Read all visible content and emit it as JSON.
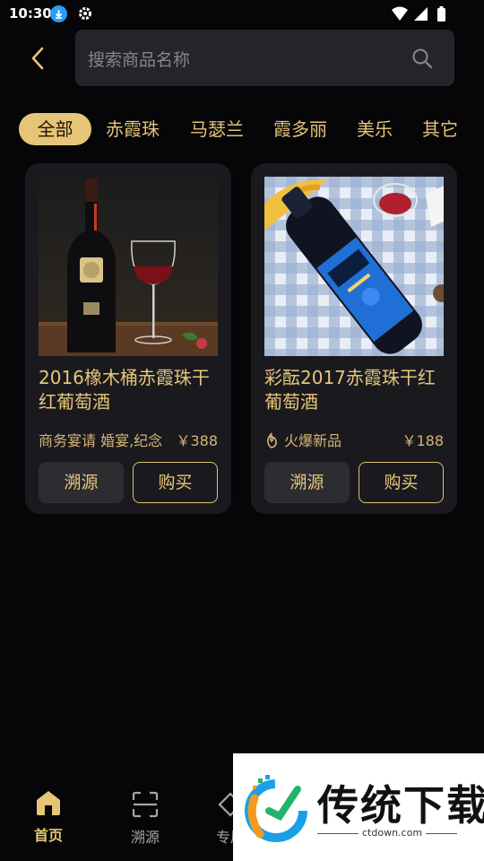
{
  "status": {
    "time": "10:30"
  },
  "search": {
    "placeholder": "搜索商品名称"
  },
  "tabs": [
    "全部",
    "赤霞珠",
    "马瑟兰",
    "霞多丽",
    "美乐",
    "其它"
  ],
  "products": [
    {
      "name": "2016橡木桶赤霞珠干红葡萄酒",
      "tag": "商务宴请 婚宴,纪念",
      "price": "￥388",
      "trace_label": "溯源",
      "buy_label": "购买"
    },
    {
      "name": "彩酝2017赤霞珠干红葡萄酒",
      "tag": "火爆新品",
      "price": "￥188",
      "trace_label": "溯源",
      "buy_label": "购买"
    }
  ],
  "nav": {
    "home": "首页",
    "trace": "溯源",
    "special": "专属"
  },
  "watermark": {
    "title": "传统下载",
    "url": "ctdown.com"
  },
  "colors": {
    "accent": "#e6c577",
    "card": "#1a1a1e",
    "background": "#060608"
  }
}
